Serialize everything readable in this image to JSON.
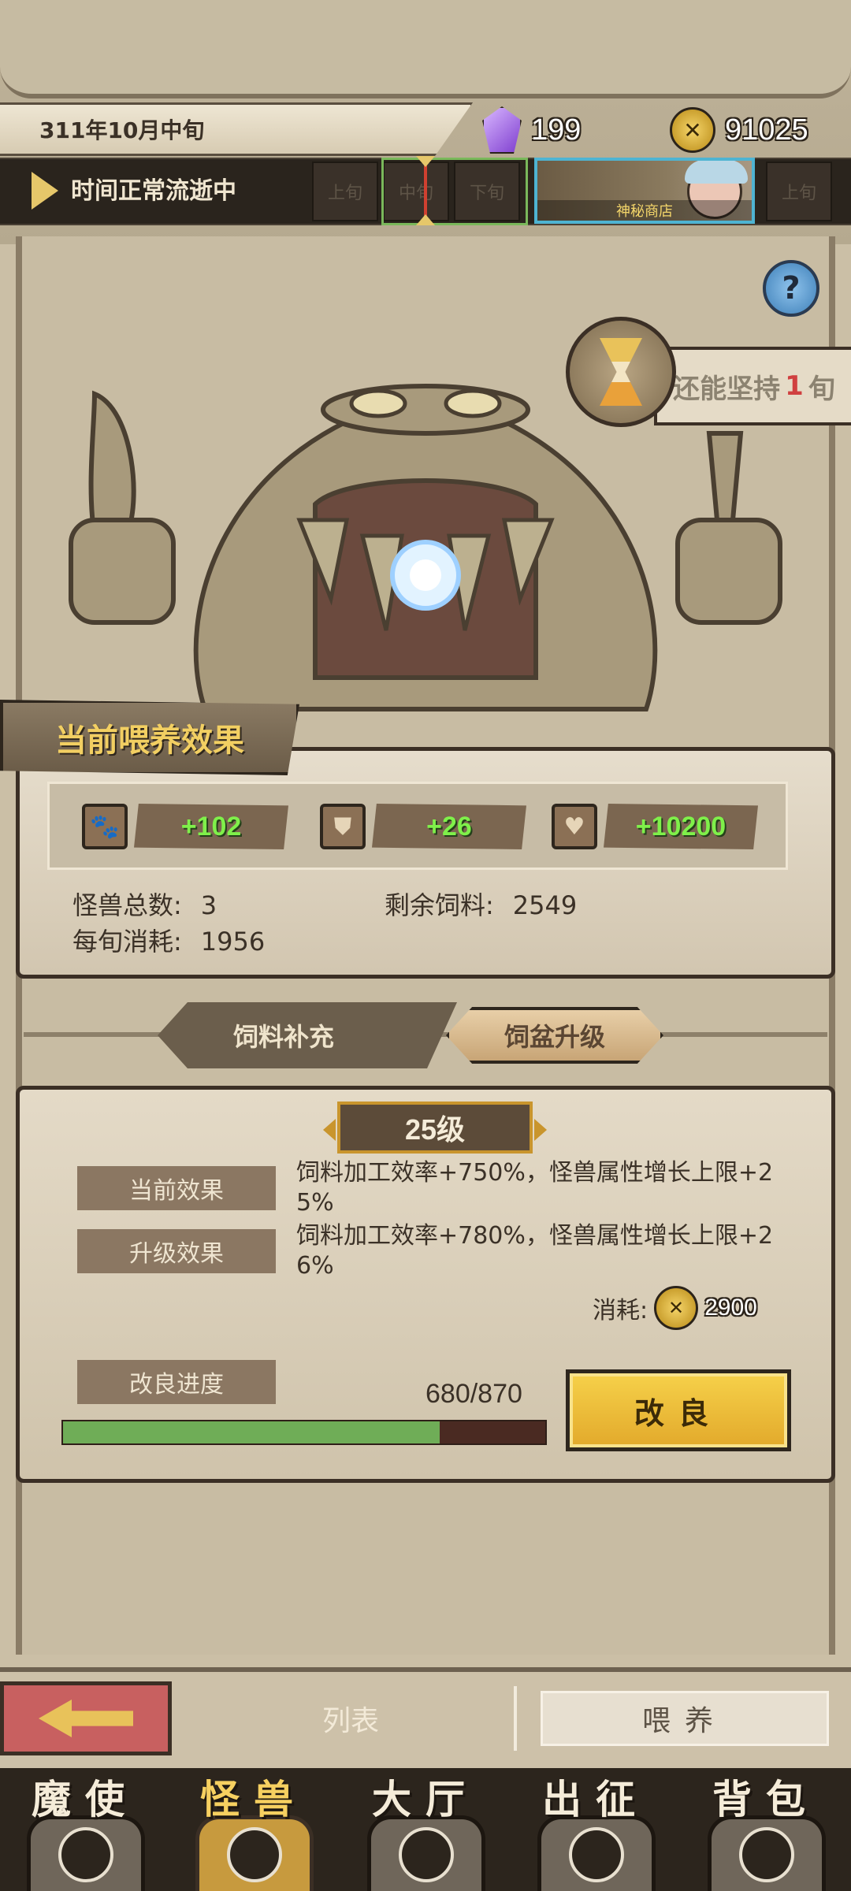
{
  "header": {
    "date": "311年10月中旬",
    "gems": "199",
    "coins": "91025"
  },
  "timeline": {
    "status": "时间正常流逝中",
    "cells": [
      "上旬",
      "中旬",
      "下旬"
    ],
    "cells_right": [
      "上旬"
    ],
    "event_label": "神秘商店"
  },
  "persist": {
    "prefix": "还能坚持",
    "count": "1",
    "suffix": "旬"
  },
  "help_icon": "question-icon",
  "feed_effect": {
    "title": "当前喂养效果",
    "stats": [
      {
        "icon": "paw-icon",
        "value": "+102"
      },
      {
        "icon": "shield-icon",
        "value": "+26"
      },
      {
        "icon": "heart-icon",
        "value": "+10200"
      }
    ],
    "monster_count_label": "怪兽总数:",
    "monster_count": "3",
    "remaining_feed_label": "剩余饲料:",
    "remaining_feed": "2549",
    "consumption_label": "每旬消耗:",
    "consumption": "1956"
  },
  "tabs": {
    "feed_supply": "饲料补充",
    "bowl_upgrade": "饲盆升级"
  },
  "upgrade": {
    "level": "25级",
    "current_label": "当前效果",
    "current_text": "饲料加工效率+750%，怪兽属性增长上限+25%",
    "next_label": "升级效果",
    "next_text": "饲料加工效率+780%，怪兽属性增长上限+26%",
    "cost_label": "消耗:",
    "cost": "2900",
    "progress_label": "改良进度",
    "progress_text": "680/870",
    "progress_current": 680,
    "progress_max": 870,
    "improve_button": "改良"
  },
  "sub_nav": {
    "list": "列表",
    "feed": "喂养"
  },
  "main_nav": [
    {
      "label": "魔使",
      "icon": "skull-icon"
    },
    {
      "label": "怪兽",
      "icon": "monster-icon"
    },
    {
      "label": "大厅",
      "icon": "hall-icon"
    },
    {
      "label": "出征",
      "icon": "helmet-icon"
    },
    {
      "label": "背包",
      "icon": "backpack-icon"
    }
  ],
  "colors": {
    "stat_value": "#7ff04a",
    "progress_fill": "#6fad57",
    "improve_button": "#f6d14a",
    "persist_count": "#d04040"
  }
}
